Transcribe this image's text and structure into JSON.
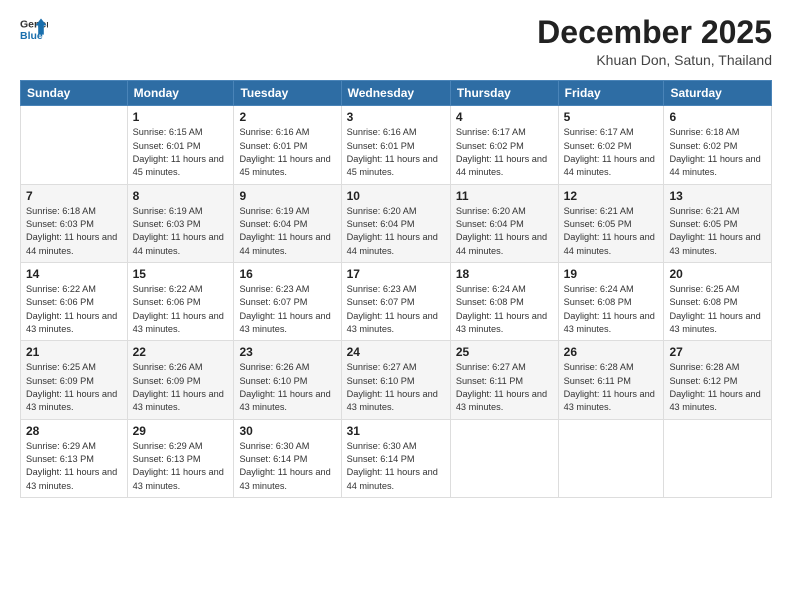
{
  "header": {
    "logo_general": "General",
    "logo_blue": "Blue",
    "month_year": "December 2025",
    "location": "Khuan Don, Satun, Thailand"
  },
  "days_of_week": [
    "Sunday",
    "Monday",
    "Tuesday",
    "Wednesday",
    "Thursday",
    "Friday",
    "Saturday"
  ],
  "weeks": [
    [
      {
        "day": "",
        "info": ""
      },
      {
        "day": "1",
        "info": "Sunrise: 6:15 AM\nSunset: 6:01 PM\nDaylight: 11 hours and 45 minutes."
      },
      {
        "day": "2",
        "info": "Sunrise: 6:16 AM\nSunset: 6:01 PM\nDaylight: 11 hours and 45 minutes."
      },
      {
        "day": "3",
        "info": "Sunrise: 6:16 AM\nSunset: 6:01 PM\nDaylight: 11 hours and 45 minutes."
      },
      {
        "day": "4",
        "info": "Sunrise: 6:17 AM\nSunset: 6:02 PM\nDaylight: 11 hours and 44 minutes."
      },
      {
        "day": "5",
        "info": "Sunrise: 6:17 AM\nSunset: 6:02 PM\nDaylight: 11 hours and 44 minutes."
      },
      {
        "day": "6",
        "info": "Sunrise: 6:18 AM\nSunset: 6:02 PM\nDaylight: 11 hours and 44 minutes."
      }
    ],
    [
      {
        "day": "7",
        "info": "Sunrise: 6:18 AM\nSunset: 6:03 PM\nDaylight: 11 hours and 44 minutes."
      },
      {
        "day": "8",
        "info": "Sunrise: 6:19 AM\nSunset: 6:03 PM\nDaylight: 11 hours and 44 minutes."
      },
      {
        "day": "9",
        "info": "Sunrise: 6:19 AM\nSunset: 6:04 PM\nDaylight: 11 hours and 44 minutes."
      },
      {
        "day": "10",
        "info": "Sunrise: 6:20 AM\nSunset: 6:04 PM\nDaylight: 11 hours and 44 minutes."
      },
      {
        "day": "11",
        "info": "Sunrise: 6:20 AM\nSunset: 6:04 PM\nDaylight: 11 hours and 44 minutes."
      },
      {
        "day": "12",
        "info": "Sunrise: 6:21 AM\nSunset: 6:05 PM\nDaylight: 11 hours and 44 minutes."
      },
      {
        "day": "13",
        "info": "Sunrise: 6:21 AM\nSunset: 6:05 PM\nDaylight: 11 hours and 43 minutes."
      }
    ],
    [
      {
        "day": "14",
        "info": "Sunrise: 6:22 AM\nSunset: 6:06 PM\nDaylight: 11 hours and 43 minutes."
      },
      {
        "day": "15",
        "info": "Sunrise: 6:22 AM\nSunset: 6:06 PM\nDaylight: 11 hours and 43 minutes."
      },
      {
        "day": "16",
        "info": "Sunrise: 6:23 AM\nSunset: 6:07 PM\nDaylight: 11 hours and 43 minutes."
      },
      {
        "day": "17",
        "info": "Sunrise: 6:23 AM\nSunset: 6:07 PM\nDaylight: 11 hours and 43 minutes."
      },
      {
        "day": "18",
        "info": "Sunrise: 6:24 AM\nSunset: 6:08 PM\nDaylight: 11 hours and 43 minutes."
      },
      {
        "day": "19",
        "info": "Sunrise: 6:24 AM\nSunset: 6:08 PM\nDaylight: 11 hours and 43 minutes."
      },
      {
        "day": "20",
        "info": "Sunrise: 6:25 AM\nSunset: 6:08 PM\nDaylight: 11 hours and 43 minutes."
      }
    ],
    [
      {
        "day": "21",
        "info": "Sunrise: 6:25 AM\nSunset: 6:09 PM\nDaylight: 11 hours and 43 minutes."
      },
      {
        "day": "22",
        "info": "Sunrise: 6:26 AM\nSunset: 6:09 PM\nDaylight: 11 hours and 43 minutes."
      },
      {
        "day": "23",
        "info": "Sunrise: 6:26 AM\nSunset: 6:10 PM\nDaylight: 11 hours and 43 minutes."
      },
      {
        "day": "24",
        "info": "Sunrise: 6:27 AM\nSunset: 6:10 PM\nDaylight: 11 hours and 43 minutes."
      },
      {
        "day": "25",
        "info": "Sunrise: 6:27 AM\nSunset: 6:11 PM\nDaylight: 11 hours and 43 minutes."
      },
      {
        "day": "26",
        "info": "Sunrise: 6:28 AM\nSunset: 6:11 PM\nDaylight: 11 hours and 43 minutes."
      },
      {
        "day": "27",
        "info": "Sunrise: 6:28 AM\nSunset: 6:12 PM\nDaylight: 11 hours and 43 minutes."
      }
    ],
    [
      {
        "day": "28",
        "info": "Sunrise: 6:29 AM\nSunset: 6:13 PM\nDaylight: 11 hours and 43 minutes."
      },
      {
        "day": "29",
        "info": "Sunrise: 6:29 AM\nSunset: 6:13 PM\nDaylight: 11 hours and 43 minutes."
      },
      {
        "day": "30",
        "info": "Sunrise: 6:30 AM\nSunset: 6:14 PM\nDaylight: 11 hours and 43 minutes."
      },
      {
        "day": "31",
        "info": "Sunrise: 6:30 AM\nSunset: 6:14 PM\nDaylight: 11 hours and 44 minutes."
      },
      {
        "day": "",
        "info": ""
      },
      {
        "day": "",
        "info": ""
      },
      {
        "day": "",
        "info": ""
      }
    ]
  ]
}
